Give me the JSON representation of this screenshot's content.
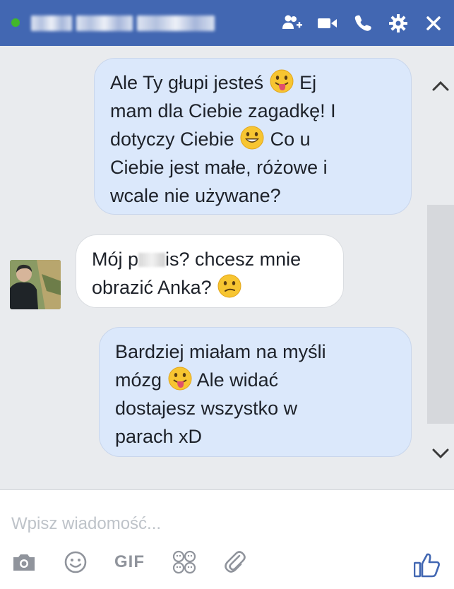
{
  "colors": {
    "header_bg": "#4267b2",
    "online": "#42b72a",
    "outgoing_bubble": "#dbe8fb",
    "incoming_bubble": "#ffffff",
    "chat_bg": "#e9ebee",
    "tool_icon": "#90949c",
    "like": "#4267b2"
  },
  "header": {
    "icons": [
      "add-people-icon",
      "video-call-icon",
      "phone-call-icon",
      "settings-icon",
      "close-icon"
    ]
  },
  "messages": [
    {
      "from": "me",
      "parts": [
        "Ale Ty głupi jesteś ",
        "tongue-emoji",
        " Ej mam dla Ciebie zagadkę! I dotyczy Ciebie ",
        "smile-emoji",
        " Co u Ciebie jest małe, różowe i wcale nie używane?"
      ]
    },
    {
      "from": "contact",
      "parts": [
        "Mój p",
        "censored",
        "is? chcesz mnie obrazić Anka? ",
        "confused-emoji"
      ]
    },
    {
      "from": "me",
      "parts": [
        "Bardziej miałam na myśli mózg ",
        "tongue-emoji",
        " Ale widać dostajesz wszystko w parach xD"
      ]
    }
  ],
  "msg1": {
    "line1": "Ale Ty głupi jesteś",
    "line1b": "Ej",
    "line2": "mam dla Ciebie zagadkę! I",
    "line3": "dotyczy Ciebie",
    "line3b": "Co u",
    "line4": "Ciebie jest małe, różowe i",
    "line5": "wcale nie używane?"
  },
  "msg2": {
    "line1a": "Mój p",
    "line1b": "is? chcesz mnie",
    "line2": "obrazić Anka?"
  },
  "msg3": {
    "line1": "Bardziej miałam na myśli",
    "line2a": "mózg",
    "line2b": "Ale widać",
    "line3": "dostajesz wszystko w",
    "line4": "parach xD"
  },
  "composer": {
    "placeholder": "Wpisz wiadomość...",
    "gif_label": "GIF",
    "tools": [
      "camera-icon",
      "emoji-icon",
      "gif-button",
      "stickers-icon",
      "attachment-icon"
    ],
    "send_icon": "thumbs-up-icon"
  }
}
